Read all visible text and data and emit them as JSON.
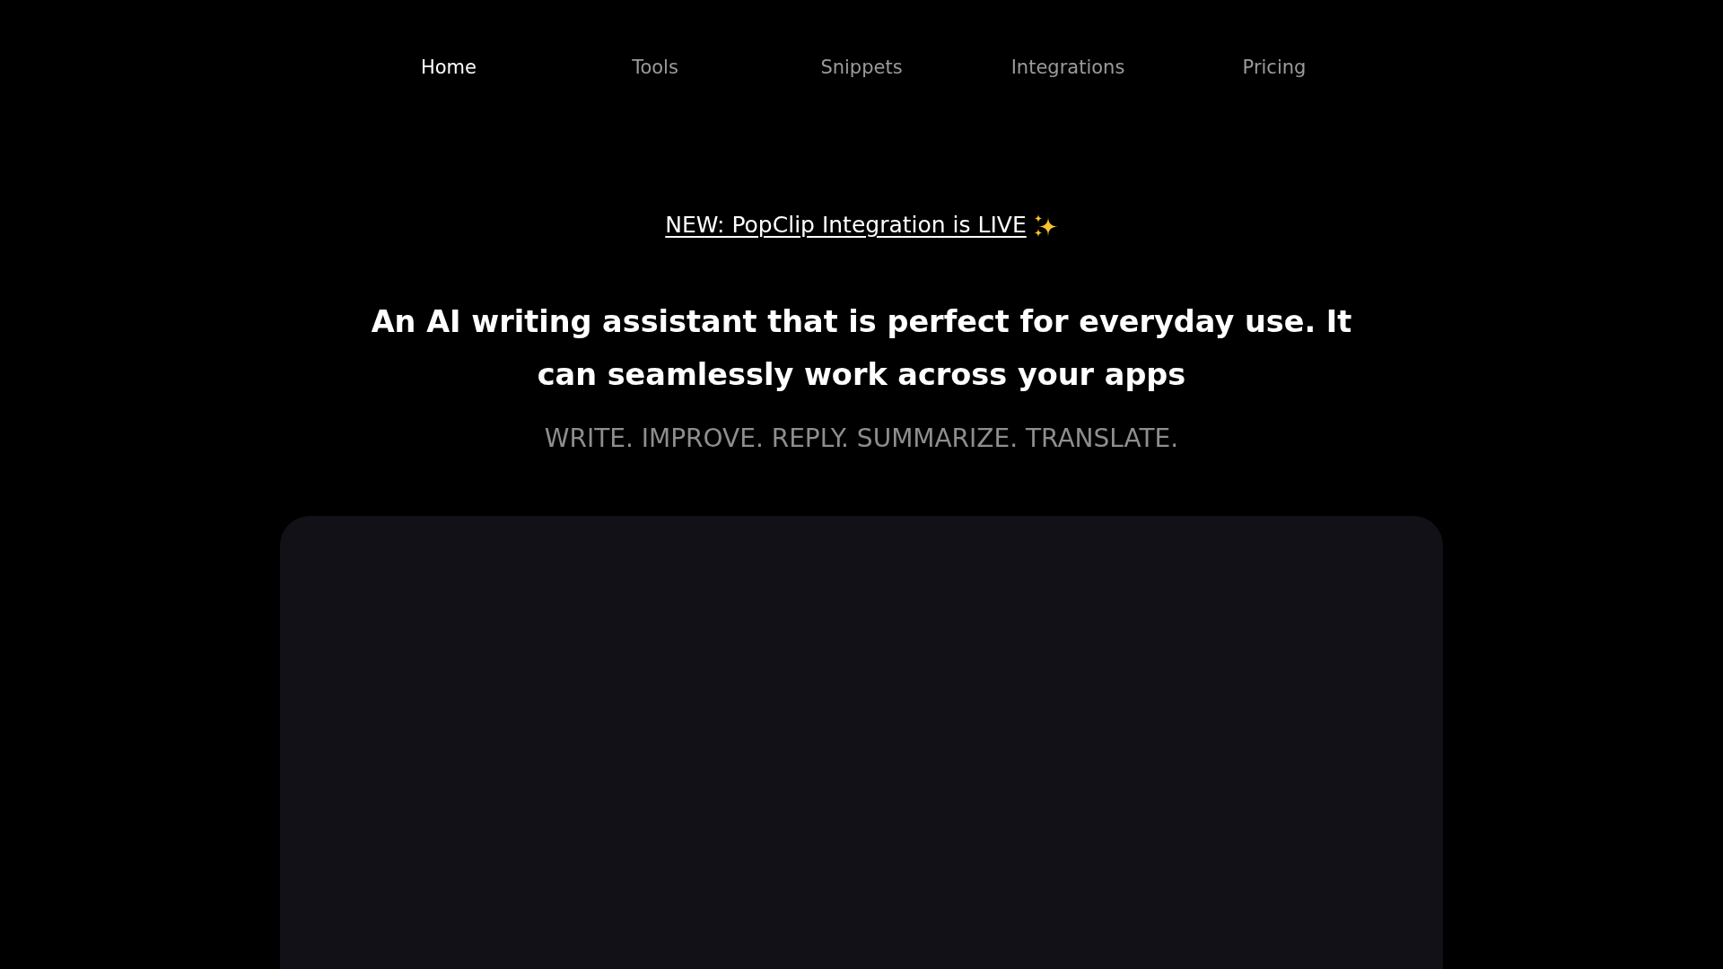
{
  "nav": {
    "items": [
      {
        "label": "Home",
        "selected": true
      },
      {
        "label": "Tools",
        "selected": false
      },
      {
        "label": "Snippets",
        "selected": false
      },
      {
        "label": "Integrations",
        "selected": false
      },
      {
        "label": "Pricing",
        "selected": false
      }
    ]
  },
  "announcement": {
    "text": "NEW: PopClip Integration is LIVE"
  },
  "hero": {
    "headline": "An AI writing assistant that is perfect for everyday use. It can seamlessly work across your apps",
    "tagline": "WRITE. IMPROVE. REPLY. SUMMARIZE. TRANSLATE."
  }
}
